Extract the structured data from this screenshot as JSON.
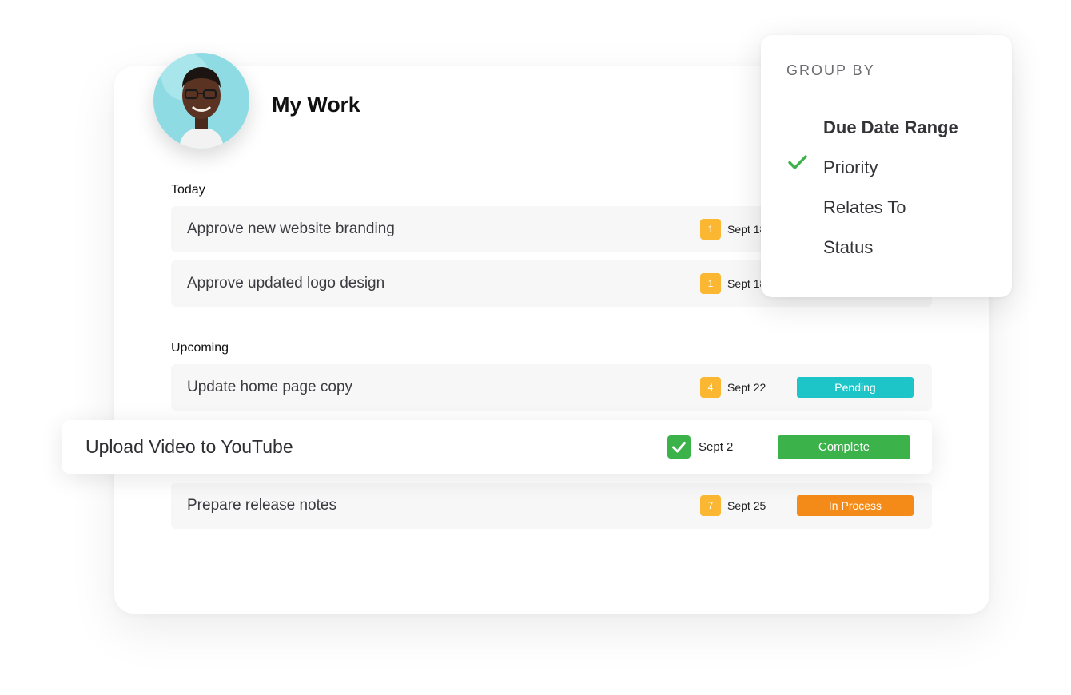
{
  "header": {
    "title": "My Work"
  },
  "sections": [
    {
      "label": "Today",
      "tasks": [
        {
          "title": "Approve new website branding",
          "priority": "1",
          "date": "Sept 18"
        },
        {
          "title": "Approve updated logo design",
          "priority": "1",
          "date": "Sept 18"
        }
      ]
    },
    {
      "label": "Upcoming",
      "tasks": [
        {
          "title": "Update home page copy",
          "priority": "4",
          "date": "Sept 22",
          "status": "Pending",
          "status_color": "#1ec5c8"
        },
        {
          "title": "Upload Video  to YouTube",
          "date": "Sept 2",
          "status": "Complete",
          "status_color": "#3bb24a",
          "done": true
        },
        {
          "title": "Prepare release notes",
          "priority": "7",
          "date": "Sept 25",
          "status": "In Process",
          "status_color": "#f48a17"
        }
      ]
    }
  ],
  "group_by": {
    "heading": "GROUP BY",
    "options": [
      {
        "label": "Due Date Range",
        "selected": true
      },
      {
        "label": "Priority"
      },
      {
        "label": "Relates To"
      },
      {
        "label": "Status"
      }
    ]
  },
  "colors": {
    "priority": "#fbb732",
    "check": "#3bb24a"
  },
  "icons": {
    "selected_option": "checkmark-icon",
    "task_done": "checkbox-checked-icon"
  }
}
